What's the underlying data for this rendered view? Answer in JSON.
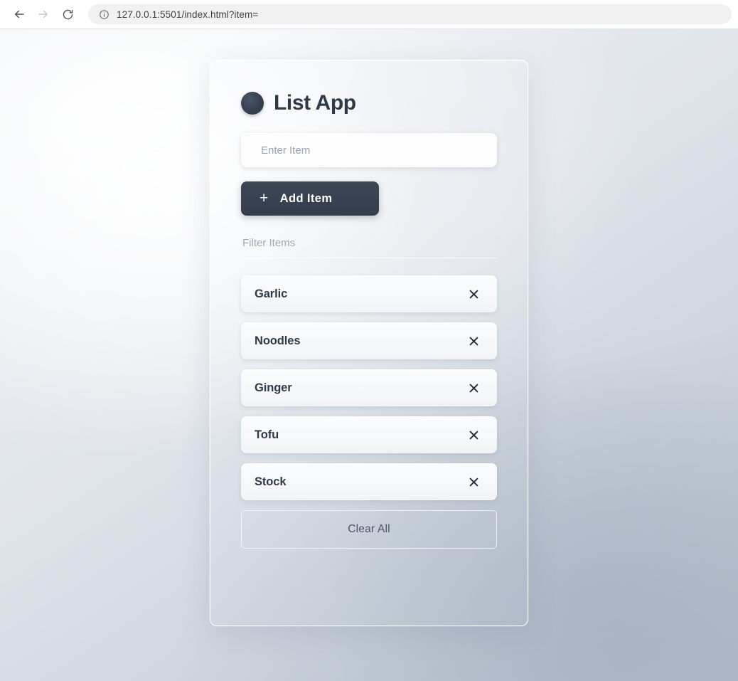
{
  "browser": {
    "back_icon": "back-arrow-icon",
    "forward_icon": "forward-arrow-icon",
    "reload_icon": "reload-icon",
    "info_icon": "info-circle-icon",
    "url": "127.0.0.1:5501/index.html?item="
  },
  "app": {
    "logo_icon": "circle-logo-icon",
    "title": "List App",
    "item_input": {
      "placeholder": "Enter Item",
      "value": ""
    },
    "add_button": {
      "icon": "plus-icon",
      "label": "Add Item"
    },
    "filter_input": {
      "placeholder": "Filter Items",
      "value": ""
    },
    "items": [
      {
        "label": "Garlic",
        "remove_icon": "close-x-icon"
      },
      {
        "label": "Noodles",
        "remove_icon": "close-x-icon"
      },
      {
        "label": "Ginger",
        "remove_icon": "close-x-icon"
      },
      {
        "label": "Tofu",
        "remove_icon": "close-x-icon"
      },
      {
        "label": "Stock",
        "remove_icon": "close-x-icon"
      }
    ],
    "clear_button": {
      "label": "Clear All"
    }
  },
  "colors": {
    "accent_dark": "#333d4c",
    "text_primary": "#2f3a49",
    "text_muted": "#9aa3b0",
    "card_border": "#ffffff",
    "background_start": "#e8ecf1",
    "background_end": "#b9c1cc"
  }
}
